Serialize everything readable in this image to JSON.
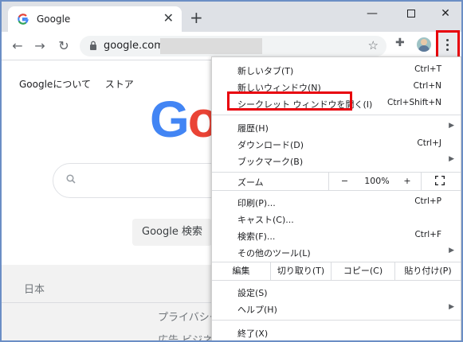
{
  "tab": {
    "title": "Google",
    "close": "✕"
  },
  "newtab": "+",
  "window": {
    "minimize": "—",
    "close": "✕"
  },
  "nav": {
    "back": "←",
    "forward": "→",
    "reload": "↻"
  },
  "omnibox": {
    "url": "google.com/",
    "star": "☆"
  },
  "extensions": "✚",
  "page": {
    "about": "Googleについて",
    "store": "ストア",
    "logo_g": "G",
    "logo_o": "o",
    "search_button": "Google 検索",
    "country": "日本",
    "privacy": "プライバシー",
    "more": "広告 ビジネス"
  },
  "menu": {
    "items": [
      {
        "label": "新しいタブ(T)",
        "shortcut": "Ctrl+T"
      },
      {
        "label": "新しいウィンドウ(N)",
        "shortcut": "Ctrl+N"
      },
      {
        "label": "シークレット ウィンドウを開く(I)",
        "shortcut": "Ctrl+Shift+N"
      },
      {
        "label": "履歴(H)",
        "shortcut": ""
      },
      {
        "label": "ダウンロード(D)",
        "shortcut": "Ctrl+J"
      },
      {
        "label": "ブックマーク(B)",
        "shortcut": ""
      },
      {
        "label": "印刷(P)...",
        "shortcut": "Ctrl+P"
      },
      {
        "label": "キャスト(C)...",
        "shortcut": ""
      },
      {
        "label": "検索(F)...",
        "shortcut": "Ctrl+F"
      },
      {
        "label": "その他のツール(L)",
        "shortcut": ""
      },
      {
        "label": "設定(S)",
        "shortcut": ""
      },
      {
        "label": "ヘルプ(H)",
        "shortcut": ""
      },
      {
        "label": "終了(X)",
        "shortcut": ""
      }
    ],
    "zoom": {
      "label": "ズーム",
      "minus": "−",
      "value": "100%",
      "plus": "+"
    },
    "edit": {
      "label": "編集",
      "cut": "切り取り(T)",
      "copy": "コピー(C)",
      "paste": "貼り付け(P)"
    },
    "submenu_arrow": "▶"
  },
  "colors": {
    "highlight": "#e8000b",
    "frame": "#6b8ec5"
  }
}
